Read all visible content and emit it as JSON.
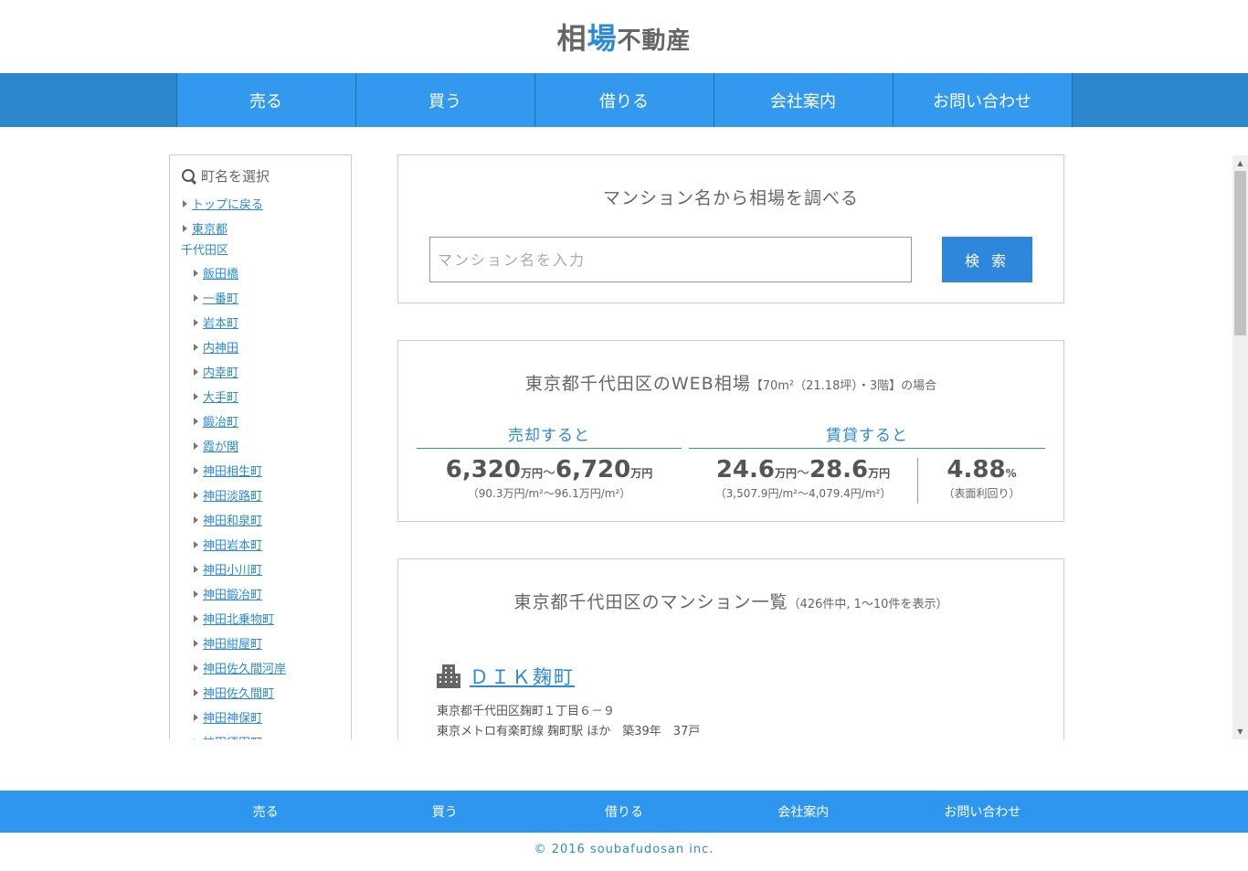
{
  "logo": {
    "part1": "相",
    "part2": "場",
    "part3": "不動産"
  },
  "nav": [
    "売る",
    "買う",
    "借りる",
    "会社案内",
    "お問い合わせ"
  ],
  "sidebar": {
    "title": "町名を選択",
    "top_links": [
      "トップに戻る",
      "東京都"
    ],
    "group": "千代田区",
    "towns": [
      "飯田橋",
      "一番町",
      "岩本町",
      "内神田",
      "内幸町",
      "大手町",
      "鍛冶町",
      "霞が関",
      "神田相生町",
      "神田淡路町",
      "神田和泉町",
      "神田岩本町",
      "神田小川町",
      "神田鍛冶町",
      "神田北乗物町",
      "神田紺屋町",
      "神田佐久間河岸",
      "神田佐久間町",
      "神田神保町",
      "神田須田町"
    ]
  },
  "search": {
    "title": "マンション名から相場を調べる",
    "placeholder": "マンション名を入力",
    "button": "検 索"
  },
  "web": {
    "title": "東京都千代田区のWEB相場",
    "note": "【70m²（21.18坪）・3階】の場合",
    "sell_head": "売却すると",
    "rent_head": "賃貸すると",
    "sell_low": "6,320",
    "sell_high": "6,720",
    "price_unit": "万円",
    "tilde": "～",
    "sell_sub": "（90.3万円/m²～96.1万円/m²）",
    "rent_low": "24.6",
    "rent_high": "28.6",
    "rent_sub": "（3,507.9円/m²～4,079.4円/m²）",
    "yield": "4.88",
    "yield_unit": "%",
    "yield_sub": "（表面利回り）"
  },
  "list": {
    "title": "東京都千代田区のマンション一覧",
    "note": "（426件中, 1～10件を表示）",
    "items": [
      {
        "name": "ＤＩＫ麹町",
        "address": "東京都千代田区麹町１丁目６－９",
        "access": "東京メトロ有楽町線 麹町駅 ほか　築39年　37戸"
      }
    ]
  },
  "footer": {
    "nav": [
      "売る",
      "買う",
      "借りる",
      "会社案内",
      "お問い合わせ"
    ],
    "copyright": "© 2016 soubafudosan inc."
  },
  "colors": {
    "accent": "#3399ee",
    "nav_bg": "#2e86cc",
    "link": "#2b8ad8"
  }
}
